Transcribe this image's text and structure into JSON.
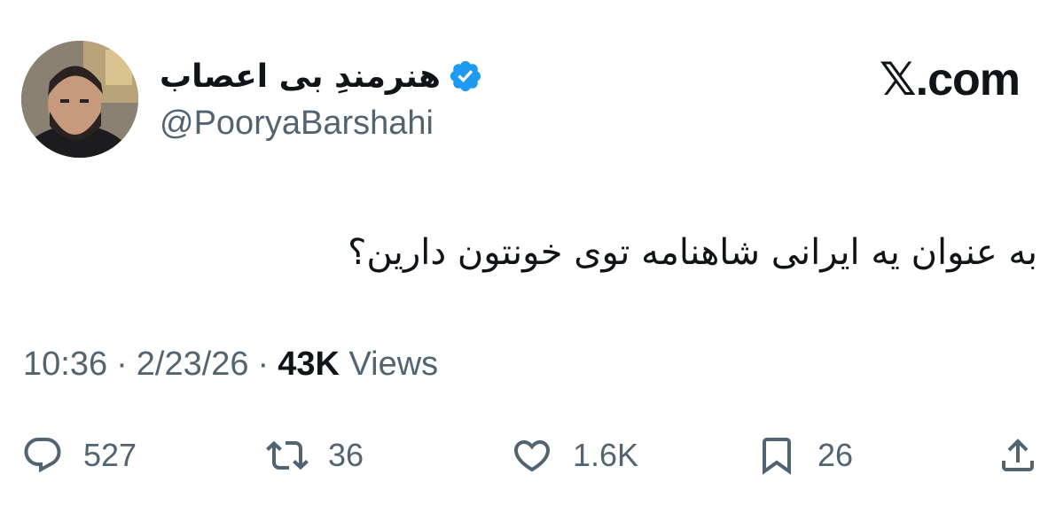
{
  "author": {
    "display_name": "هنرمندِ بی اعصاب",
    "handle": "@PooryaBarshahi",
    "verified": true
  },
  "site_logo": "𝕏.com",
  "tweet": {
    "text": "به عنوان یه ایرانی شاهنامه توی خونتون دارین؟"
  },
  "meta": {
    "time": "10:36",
    "separator": "·",
    "date": "2/23/26",
    "views_count": "43K",
    "views_label": "Views"
  },
  "actions": {
    "replies": "527",
    "retweets": "36",
    "likes": "1.6K",
    "bookmarks": "26"
  },
  "colors": {
    "text_primary": "#0f1419",
    "text_secondary": "#536471",
    "verified_blue": "#1d9bf0",
    "background": "#ffffff"
  },
  "icons": {
    "reply": "speech-bubble-icon",
    "retweet": "retweet-arrows-icon",
    "like": "heart-icon",
    "bookmark": "bookmark-icon",
    "share": "share-upload-icon",
    "verified": "verified-badge-icon"
  }
}
